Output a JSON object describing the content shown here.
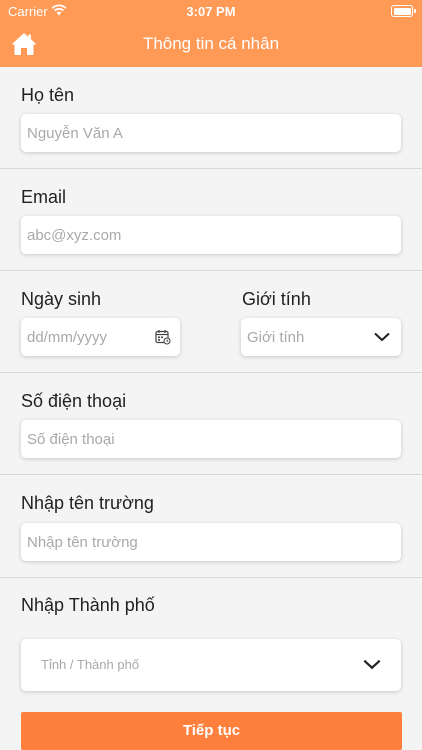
{
  "status_bar": {
    "carrier": "Carrier",
    "time": "3:07 PM"
  },
  "header": {
    "title": "Thông tin cá nhân",
    "home_icon": "home-icon"
  },
  "form": {
    "full_name": {
      "label": "Họ tên",
      "placeholder": "Nguyễn Văn A"
    },
    "email": {
      "label": "Email",
      "placeholder": "abc@xyz.com"
    },
    "birth_date": {
      "label": "Ngày sinh",
      "placeholder": "dd/mm/yyyy",
      "icon": "calendar-icon"
    },
    "gender": {
      "label": "Giới tính",
      "selected": "Giới tính"
    },
    "phone": {
      "label": "Số điện thoại",
      "placeholder": "Số điện thoại"
    },
    "school": {
      "label": "Nhập tên trường",
      "placeholder": "Nhập tên trường"
    },
    "city": {
      "label": "Nhập Thành phố",
      "selected": "Tỉnh / Thành phố"
    }
  },
  "actions": {
    "continue_label": "Tiếp tục"
  },
  "colors": {
    "header": "#ff9a56",
    "button": "#ff7f3d",
    "background": "#f4f4f4"
  }
}
